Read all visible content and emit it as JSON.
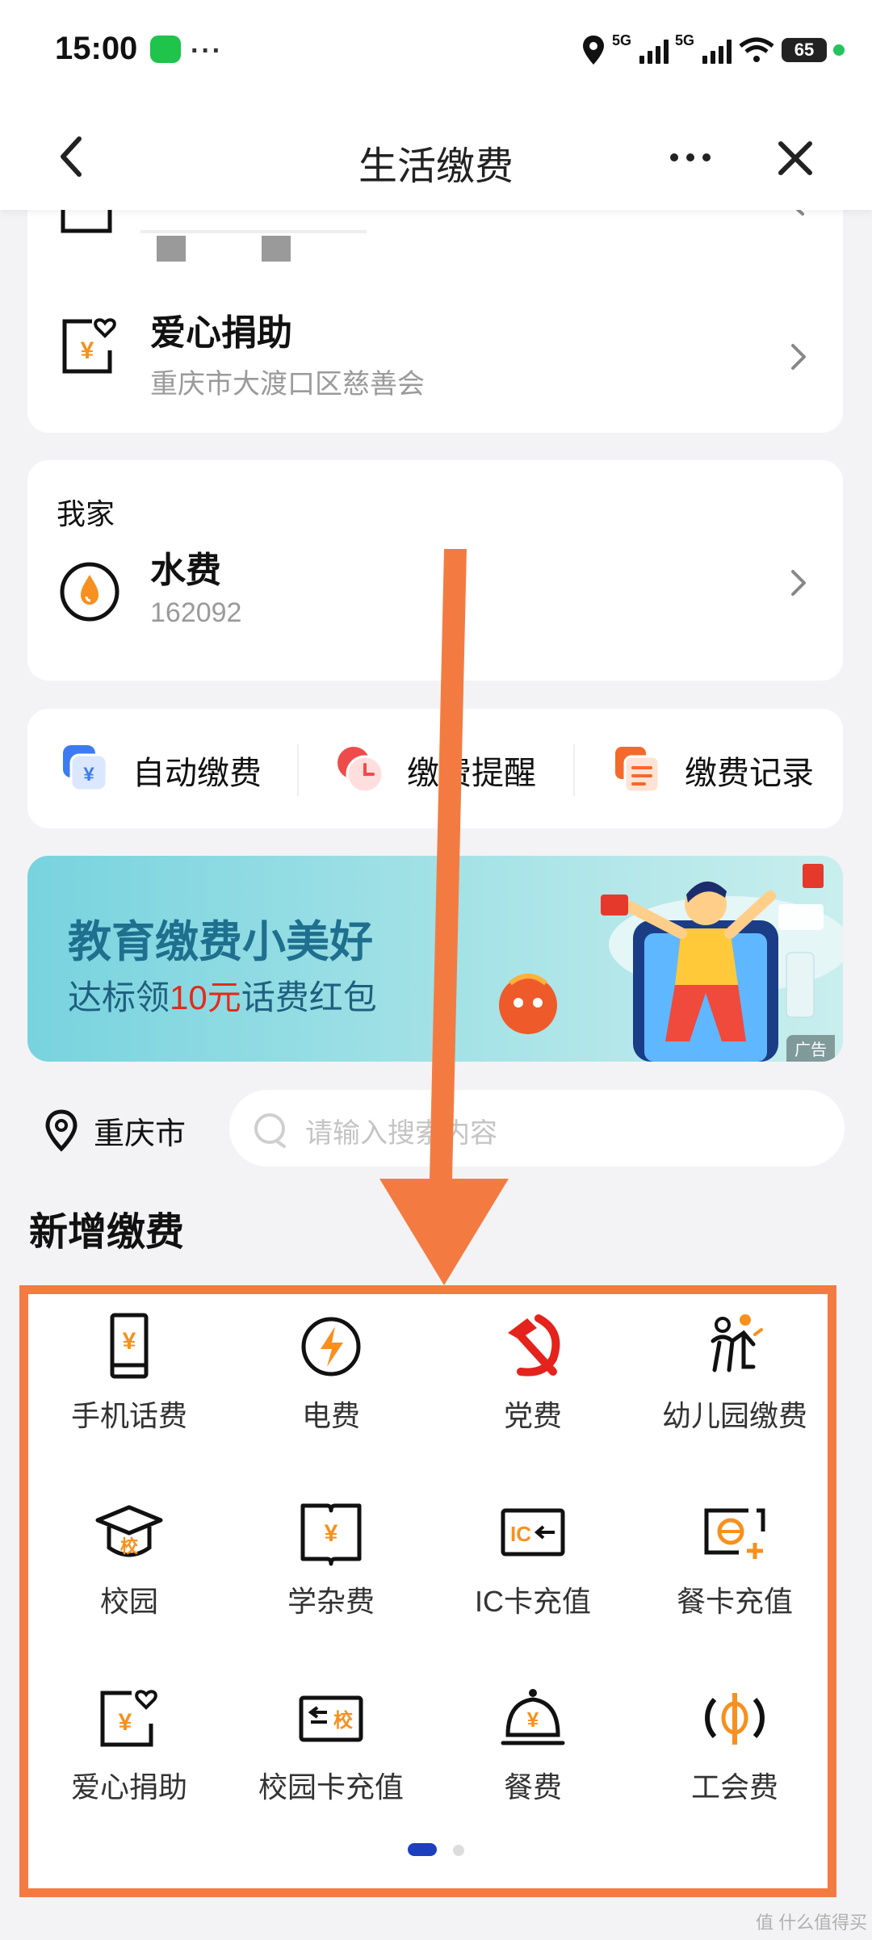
{
  "status_bar": {
    "time": "15:00",
    "more": "···",
    "net1": "5G",
    "net2": "5G",
    "battery": "65"
  },
  "header": {
    "title": "生活缴费"
  },
  "donation": {
    "title": "爱心捐助",
    "subtitle": "重庆市大渡口区慈善会"
  },
  "home": {
    "section": "我家",
    "water_title": "水费",
    "water_account": "162092"
  },
  "quick_actions": [
    {
      "label": "自动缴费"
    },
    {
      "label": "缴费提醒"
    },
    {
      "label": "缴费记录"
    }
  ],
  "banner": {
    "headline": "教育缴费小美好",
    "line2_pre": "达标领",
    "line2_accent": "10元",
    "line2_post": "话费红包",
    "ad_tag": "广告",
    "colors": {
      "headline": "#1f6f8e",
      "accent": "#e52a1a"
    }
  },
  "location": {
    "city": "重庆市"
  },
  "search": {
    "placeholder": "请输入搜索内容"
  },
  "new_pay": {
    "title": "新增缴费",
    "items": [
      {
        "label": "手机话费",
        "icon": "phone-bill-icon"
      },
      {
        "label": "电费",
        "icon": "electricity-icon"
      },
      {
        "label": "党费",
        "icon": "party-emblem-icon"
      },
      {
        "label": "幼儿园缴费",
        "icon": "kindergarten-icon"
      },
      {
        "label": "校园",
        "icon": "graduation-cap-icon"
      },
      {
        "label": "学杂费",
        "icon": "tuition-book-icon"
      },
      {
        "label": "IC卡充值",
        "icon": "ic-card-icon"
      },
      {
        "label": "餐卡充值",
        "icon": "meal-card-icon"
      },
      {
        "label": "爱心捐助",
        "icon": "donation-icon"
      },
      {
        "label": "校园卡充值",
        "icon": "campus-card-icon"
      },
      {
        "label": "餐费",
        "icon": "meal-bell-icon"
      },
      {
        "label": "工会费",
        "icon": "union-fee-icon"
      }
    ]
  },
  "watermark": "值 什么值得买",
  "colors": {
    "accent_orange": "#f7901e",
    "annotation_orange": "#f37b42",
    "page_bg": "#f3f3f5",
    "dot_active": "#1d3fbf"
  }
}
